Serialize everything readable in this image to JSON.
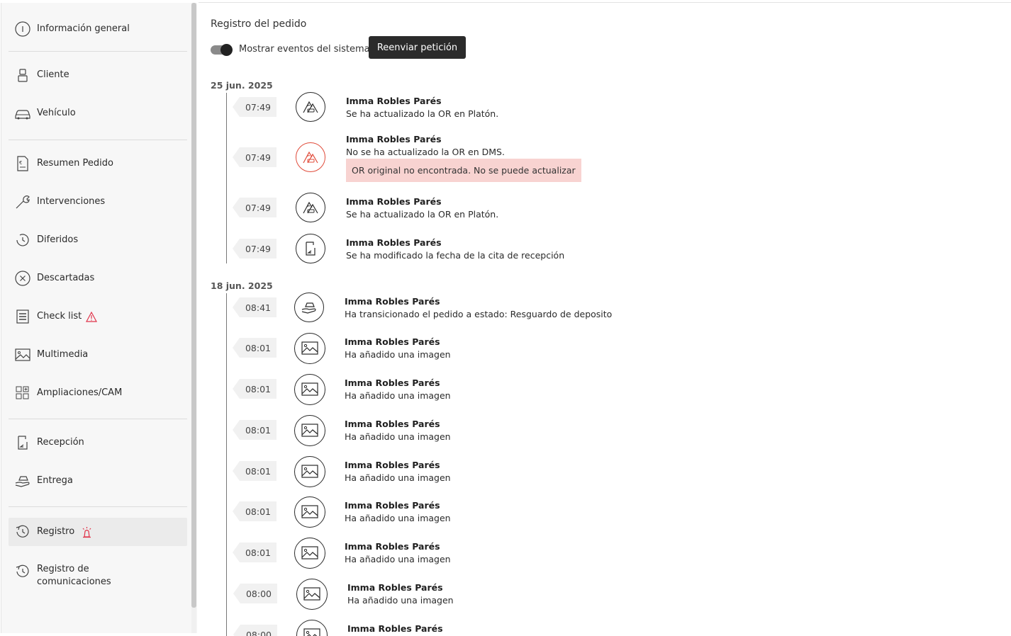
{
  "sidebar": {
    "items": [
      {
        "label": "Información general",
        "icon": "info-icon"
      },
      {
        "label": "Cliente",
        "icon": "user-icon"
      },
      {
        "label": "Vehículo",
        "icon": "car-icon"
      },
      {
        "label": "Resumen Pedido",
        "icon": "euro-document-icon"
      },
      {
        "label": "Intervenciones",
        "icon": "wrench-icon"
      },
      {
        "label": "Diferidos",
        "icon": "deferred-clock-icon"
      },
      {
        "label": "Descartadas",
        "icon": "x-circle-icon"
      },
      {
        "label": "Check list",
        "icon": "checklist-icon",
        "warning": "warning-triangle-icon"
      },
      {
        "label": "Multimedia",
        "icon": "image-icon"
      },
      {
        "label": "Ampliaciones/CAM",
        "icon": "grid-plus-icon"
      },
      {
        "label": "Recepción",
        "icon": "reception-icon"
      },
      {
        "label": "Entrega",
        "icon": "delivery-hand-icon"
      },
      {
        "label": "Registro",
        "icon": "history-icon",
        "warning": "alert-beacon-icon",
        "active": true
      },
      {
        "label_line1": "Registro de",
        "label_line2": "comunicaciones",
        "icon": "history-icon"
      }
    ]
  },
  "main": {
    "title": "Registro del pedido",
    "toggle": {
      "label": "Mostrar eventos del sistema",
      "on": true
    },
    "resend_button": "Reenviar petición",
    "groups": [
      {
        "date": "25 jun. 2025",
        "events": [
          {
            "time": "07:49",
            "author": "Imma Robles Parés",
            "message": "Se ha actualizado la OR en Platón.",
            "icon": "sync-triangle-icon"
          },
          {
            "time": "07:49",
            "author": "Imma Robles Parés",
            "message": "No se ha actualizado la OR en DMS.",
            "error": "OR original no encontrada. No se puede actualizar",
            "icon": "sync-triangle-icon",
            "status_color": "#e04b3a"
          },
          {
            "time": "07:49",
            "author": "Imma Robles Parés",
            "message": "Se ha actualizado la OR en Platón.",
            "icon": "sync-triangle-icon"
          },
          {
            "time": "07:49",
            "author": "Imma Robles Parés",
            "message": "Se ha modificado la fecha de la cita de recepción",
            "icon": "reception-icon"
          }
        ]
      },
      {
        "date": "18 jun. 2025",
        "events": [
          {
            "time": "08:41",
            "author": "Imma Robles Parés",
            "message": "Ha transicionado el pedido a estado: Resguardo de deposito",
            "icon": "delivery-hand-icon"
          },
          {
            "time": "08:01",
            "author": "Imma Robles Parés",
            "message": "Ha añadido una imagen",
            "icon": "image-icon"
          },
          {
            "time": "08:01",
            "author": "Imma Robles Parés",
            "message": "Ha añadido una imagen",
            "icon": "image-icon"
          },
          {
            "time": "08:01",
            "author": "Imma Robles Parés",
            "message": "Ha añadido una imagen",
            "icon": "image-icon"
          },
          {
            "time": "08:01",
            "author": "Imma Robles Parés",
            "message": "Ha añadido una imagen",
            "icon": "image-icon"
          },
          {
            "time": "08:01",
            "author": "Imma Robles Parés",
            "message": "Ha añadido una imagen",
            "icon": "image-icon"
          },
          {
            "time": "08:01",
            "author": "Imma Robles Parés",
            "message": "Ha añadido una imagen",
            "icon": "image-icon"
          },
          {
            "time": "08:00",
            "author": "Imma Robles Parés",
            "message": "Ha añadido una imagen",
            "icon": "image-icon"
          },
          {
            "time": "08:00",
            "author": "Imma Robles Parés",
            "message": "",
            "icon": "image-icon"
          }
        ]
      }
    ]
  },
  "colors": {
    "accent_dark": "#2b2b2b",
    "error_bg": "#f8d3d1",
    "error_icon": "#e04b3a",
    "warning": "#e0334a"
  }
}
